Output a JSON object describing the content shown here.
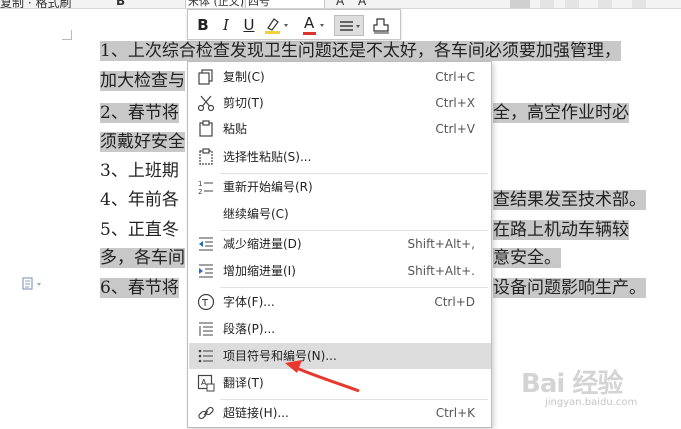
{
  "ribbon": {
    "left_text": "复制 · 格式刷",
    "font_name": "宋体 (正文)",
    "font_size": "四号",
    "letter_a": "A",
    "bold_b": "B"
  },
  "document": {
    "paragraphs": [
      {
        "plain": "",
        "marked": "1、上次综合检查发现卫生问题还是不太好，各车间必须要加强管理，",
        "prefix_plain": "1、"
      },
      {
        "plain": "",
        "marked": "加大检查与",
        "prefix_plain": ""
      },
      {
        "plain": "",
        "marked": "2、春节将",
        "tail": "全，高空作业时必",
        "prefix_plain": "2、"
      },
      {
        "plain": "",
        "marked": "须戴好安全",
        "prefix_plain": ""
      },
      {
        "plain": "3、上班期",
        "marked": "",
        "prefix_plain": ""
      },
      {
        "plain": "4、年前各",
        "marked": "",
        "tail": "查结果发至技术部。",
        "prefix_plain": ""
      },
      {
        "plain": "5、正直冬",
        "marked": "",
        "tail": "在路上机动车辆较",
        "prefix_plain": ""
      },
      {
        "plain": "多，各车间",
        "marked": "",
        "tail": "意安全。",
        "prefix_plain": ""
      },
      {
        "plain": "6、春节将",
        "marked": "",
        "tail": "设备问题影响生产。",
        "prefix_plain": ""
      }
    ]
  },
  "minibar": {
    "bold": "B",
    "italic": "I",
    "underline": "U",
    "highlight_icon": "highlight-icon",
    "font_color": "A",
    "align_icon": "align-icon",
    "eraser_icon": "eraser-icon"
  },
  "context_menu": {
    "items": [
      {
        "icon": "copy-icon",
        "label": "复制(C)",
        "shortcut": "Ctrl+C"
      },
      {
        "icon": "cut-icon",
        "label": "剪切(T)",
        "shortcut": "Ctrl+X"
      },
      {
        "icon": "paste-icon",
        "label": "粘贴",
        "shortcut": "Ctrl+V"
      },
      {
        "icon": "paste-special-icon",
        "label": "选择性粘贴(S)...",
        "shortcut": ""
      },
      {
        "icon": "restart-numbering-icon",
        "label": "重新开始编号(R)",
        "shortcut": ""
      },
      {
        "icon": "",
        "label": "继续编号(C)",
        "shortcut": ""
      },
      {
        "icon": "decrease-indent-icon",
        "label": "减少缩进量(D)",
        "shortcut": "Shift+Alt+,"
      },
      {
        "icon": "increase-indent-icon",
        "label": "增加缩进量(I)",
        "shortcut": "Shift+Alt+."
      },
      {
        "icon": "font-icon",
        "label": "字体(F)...",
        "shortcut": "Ctrl+D"
      },
      {
        "icon": "paragraph-icon",
        "label": "段落(P)...",
        "shortcut": ""
      },
      {
        "icon": "bullets-numbering-icon",
        "label": "项目符号和编号(N)...",
        "shortcut": ""
      },
      {
        "icon": "translate-icon",
        "label": "翻译(T)",
        "shortcut": ""
      },
      {
        "icon": "hyperlink-icon",
        "label": "超链接(H)...",
        "shortcut": "Ctrl+K"
      }
    ]
  },
  "watermark": {
    "main": "Bai 经验",
    "sub": "jingyan.baidu.com"
  },
  "colors": {
    "selection": "#c8c8c8",
    "menu_hover": "#dcdcdc",
    "arrow": "#e8372c",
    "highlight_yellow": "#f4d03f",
    "font_red": "#e03131"
  }
}
